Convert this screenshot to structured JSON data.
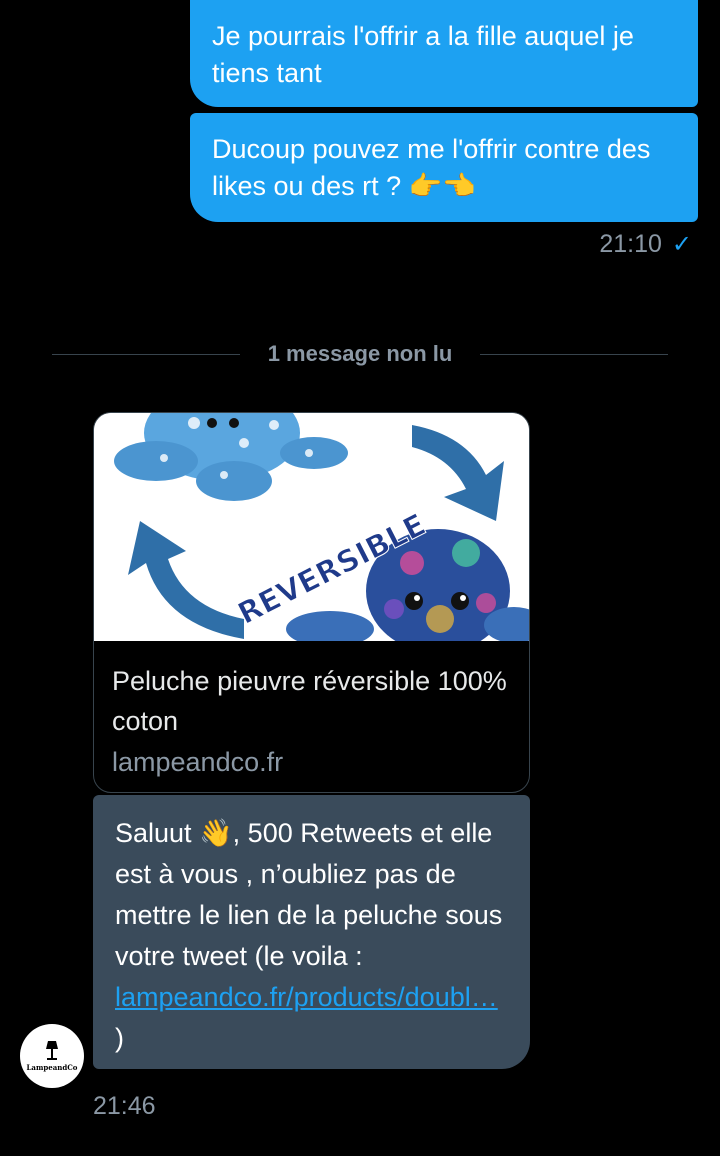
{
  "conversation": {
    "outgoing": [
      {
        "text": "Je pourrais l'offrir a la fille auquel je tiens tant"
      },
      {
        "text": "Ducoup pouvez me l'offrir contre des likes ou des rt ? 👉👈"
      }
    ],
    "outgoing_time": "21:10",
    "read_icon": "check-icon",
    "unread_divider": "1 message non lu",
    "link_card": {
      "image_text": "REVERSIBLE",
      "title": "Peluche pieuvre réversible 100% coton",
      "domain": "lampeandco.fr"
    },
    "incoming": {
      "text_before": "Saluut 👋, 500 Retweets et elle est à vous , n’oubliez pas de mettre le lien de la peluche sous votre tweet (le voila : ",
      "link": "lampeandco.fr/products/doubl…",
      "text_after": " )"
    },
    "incoming_time": "21:46",
    "sender_avatar": {
      "label": "LampeandCo",
      "icon": "lamp-icon"
    }
  },
  "colors": {
    "background": "#000000",
    "outgoing_bubble": "#1DA1F2",
    "incoming_bubble": "#3a4b5b",
    "secondary_text": "#8b98a5",
    "link": "#1DA1F2"
  }
}
